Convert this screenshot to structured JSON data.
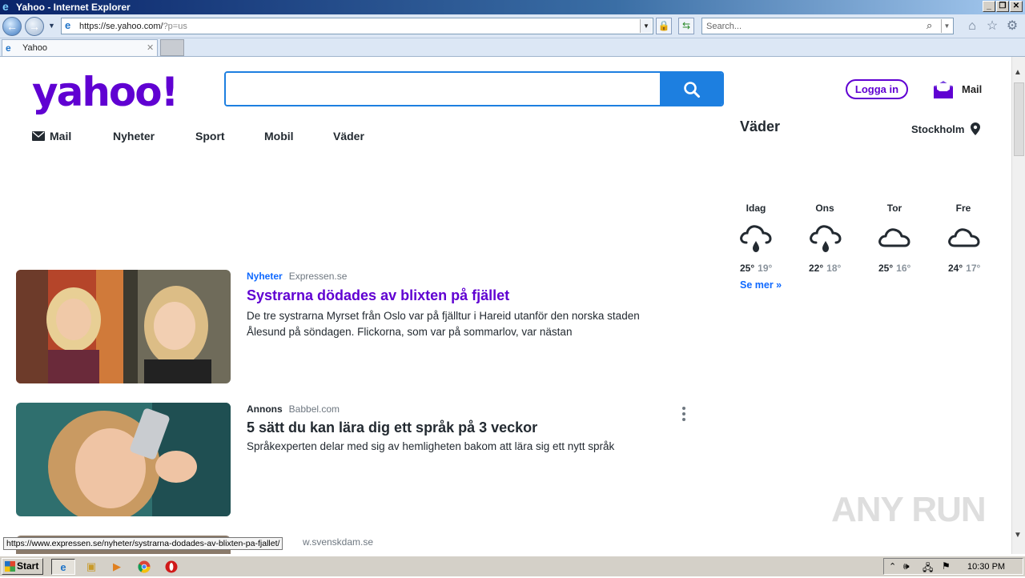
{
  "window": {
    "title": "Yahoo - Internet Explorer",
    "address_prefix": "https://se.yahoo.com/",
    "address_suffix": "?p=us",
    "search_placeholder": "Search...",
    "tab_label": "Yahoo"
  },
  "header": {
    "logo": "yahoo!",
    "search_value": "",
    "login_label": "Logga in",
    "mail_label": "Mail"
  },
  "nav": [
    {
      "label": "Mail"
    },
    {
      "label": "Nyheter"
    },
    {
      "label": "Sport"
    },
    {
      "label": "Mobil"
    },
    {
      "label": "Väder"
    }
  ],
  "feed": [
    {
      "category": "Nyheter",
      "source": "Expressen.se",
      "title": "Systrarna dödades av blixten på fjället",
      "description": "De tre systrarna Myrset från Oslo var på fjälltur i Hareid utanför den norska staden Ålesund på söndagen. Flickorna, som var på sommarlov, var nästan"
    },
    {
      "category": "Annons",
      "source": "Babbel.com",
      "title": "5 sätt du kan lära dig ett språk på 3 veckor",
      "description": "Språkexperten delar med sig av hemligheten bakom att lära sig ett nytt språk"
    }
  ],
  "weather": {
    "title": "Väder",
    "location": "Stockholm",
    "days": [
      {
        "label": "Idag",
        "icon": "rain-cloud-icon",
        "high": "25°",
        "low": "19°"
      },
      {
        "label": "Ons",
        "icon": "rain-cloud-icon",
        "high": "22°",
        "low": "18°"
      },
      {
        "label": "Tor",
        "icon": "cloud-icon",
        "high": "25°",
        "low": "16°"
      },
      {
        "label": "Fre",
        "icon": "cloud-icon",
        "high": "24°",
        "low": "17°"
      }
    ],
    "more_label": "Se mer »"
  },
  "status": {
    "hover_url": "https://www.expressen.se/nyheter/systrarna-dodades-av-blixten-pa-fjallet/",
    "peek_source": "w.svenskdam.se"
  },
  "watermark": "ANY RUN",
  "taskbar": {
    "start_label": "Start",
    "clock": "10:30 PM"
  },
  "colors": {
    "brand_purple": "#6001d2",
    "search_blue": "#1d7fe0",
    "link_blue": "#0f69ff",
    "category_blue": "#0f69ff"
  }
}
